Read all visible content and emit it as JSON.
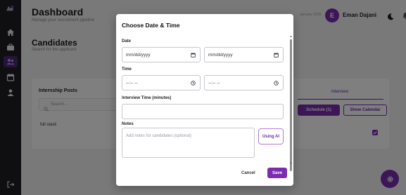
{
  "sidebar": {
    "items": [
      {
        "icon": "home-icon"
      },
      {
        "icon": "briefcase-icon"
      },
      {
        "icon": "users-icon",
        "active": true
      },
      {
        "icon": "calendar-icon"
      },
      {
        "icon": "user-icon"
      }
    ],
    "logout_icon": "logout-icon"
  },
  "header": {
    "title": "Dashboard",
    "subtitle": "Manage your recruitment pipeline",
    "date_text": "January 2026",
    "avatar_initial": "E",
    "user_name": "Eman Dajani"
  },
  "page": {
    "title": "Candidates",
    "subtitle": "Search for the applicant"
  },
  "posts_card": {
    "title": "Internship Posts",
    "search_placeholder": "Search...",
    "items": [
      "full stack"
    ]
  },
  "right_card": {
    "tab_label": "Interview",
    "schedule_label": "Schedule (1)",
    "calendar_label": "Show Calendar",
    "checked": true
  },
  "modal": {
    "title": "Choose Date & Time",
    "date_label": "Date",
    "date1_value": "mm/dd/yyyy",
    "date2_value": "mm/dd/yyyy",
    "time_label": "Time",
    "time1_value": "--:-- --",
    "time2_value": "--:-- --",
    "duration_label": "Interview Time (minutes)",
    "duration_value": "",
    "notes_label": "Notes",
    "notes_placeholder": "Add notes for candidates (optional)",
    "ai_button": "Using AI",
    "cancel_button": "Cancel",
    "save_button": "Save"
  },
  "colors": {
    "accent": "#7b2cb0",
    "sidebar_bg": "#1f1f24",
    "overlay": "rgba(0,0,0,0.5)"
  }
}
